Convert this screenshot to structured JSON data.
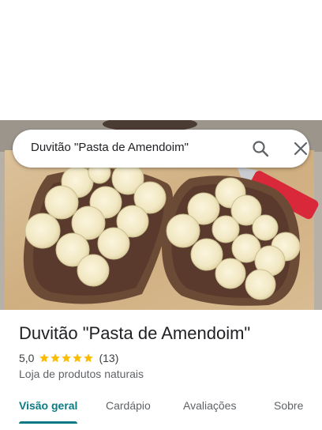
{
  "search": {
    "query": "Duvitão \"Pasta de Amendoim\""
  },
  "place": {
    "title": "Duvitão \"Pasta de Amendoim\"",
    "rating": "5,0",
    "stars": 5,
    "review_count": "(13)",
    "category": "Loja de produtos naturais"
  },
  "tabs": [
    {
      "label": "Visão geral",
      "active": true
    },
    {
      "label": "Cardápio",
      "active": false
    },
    {
      "label": "Avaliações",
      "active": false
    },
    {
      "label": "Sobre",
      "active": false
    }
  ],
  "colors": {
    "accent": "#0b7a83",
    "star": "#fbbc04"
  },
  "icons": [
    "search-icon",
    "close-icon",
    "star-icon"
  ]
}
